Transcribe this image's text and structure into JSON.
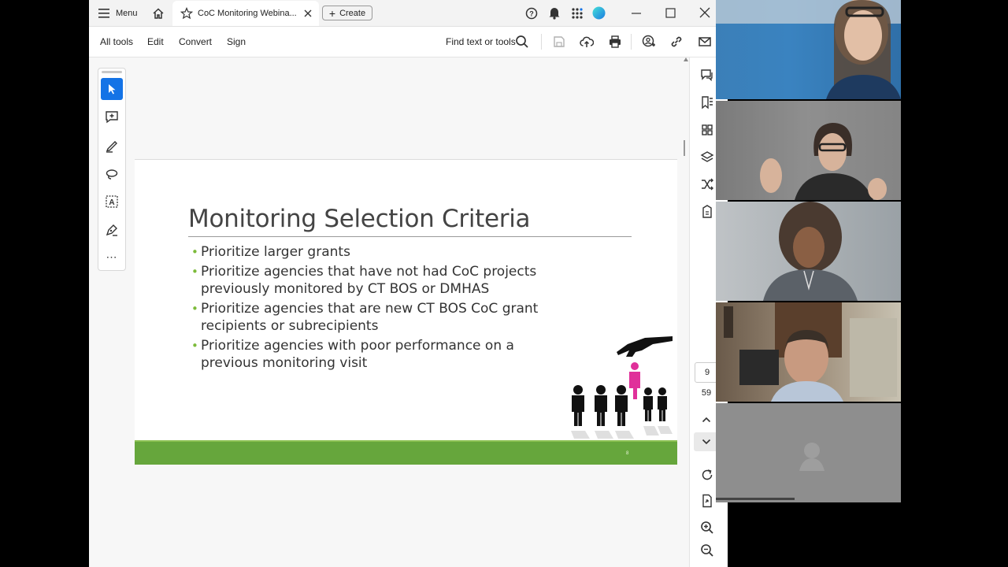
{
  "titlebar": {
    "menu_label": "Menu",
    "tab_title": "CoC Monitoring Webina...",
    "create_label": "Create"
  },
  "toolbar": {
    "all_tools": "All tools",
    "edit": "Edit",
    "convert": "Convert",
    "sign": "Sign",
    "find": "Find text or tools"
  },
  "slide": {
    "title": "Monitoring Selection Criteria",
    "bullets": [
      "Prioritize larger grants",
      "Prioritize agencies that have not had CoC projects previously monitored by CT BOS or DMHAS",
      "Prioritize agencies that are new CT BOS CoC grant recipients or subrecipients",
      "Prioritize agencies with poor performance on a previous monitoring visit"
    ],
    "page_mark": "8"
  },
  "navigation": {
    "current_page": "9",
    "total_pages": "59"
  },
  "colors": {
    "accent": "#1473e6",
    "slide_green": "#66a63c",
    "bullet_green": "#7cbb3a",
    "highlight_figure": "#e0309a"
  }
}
